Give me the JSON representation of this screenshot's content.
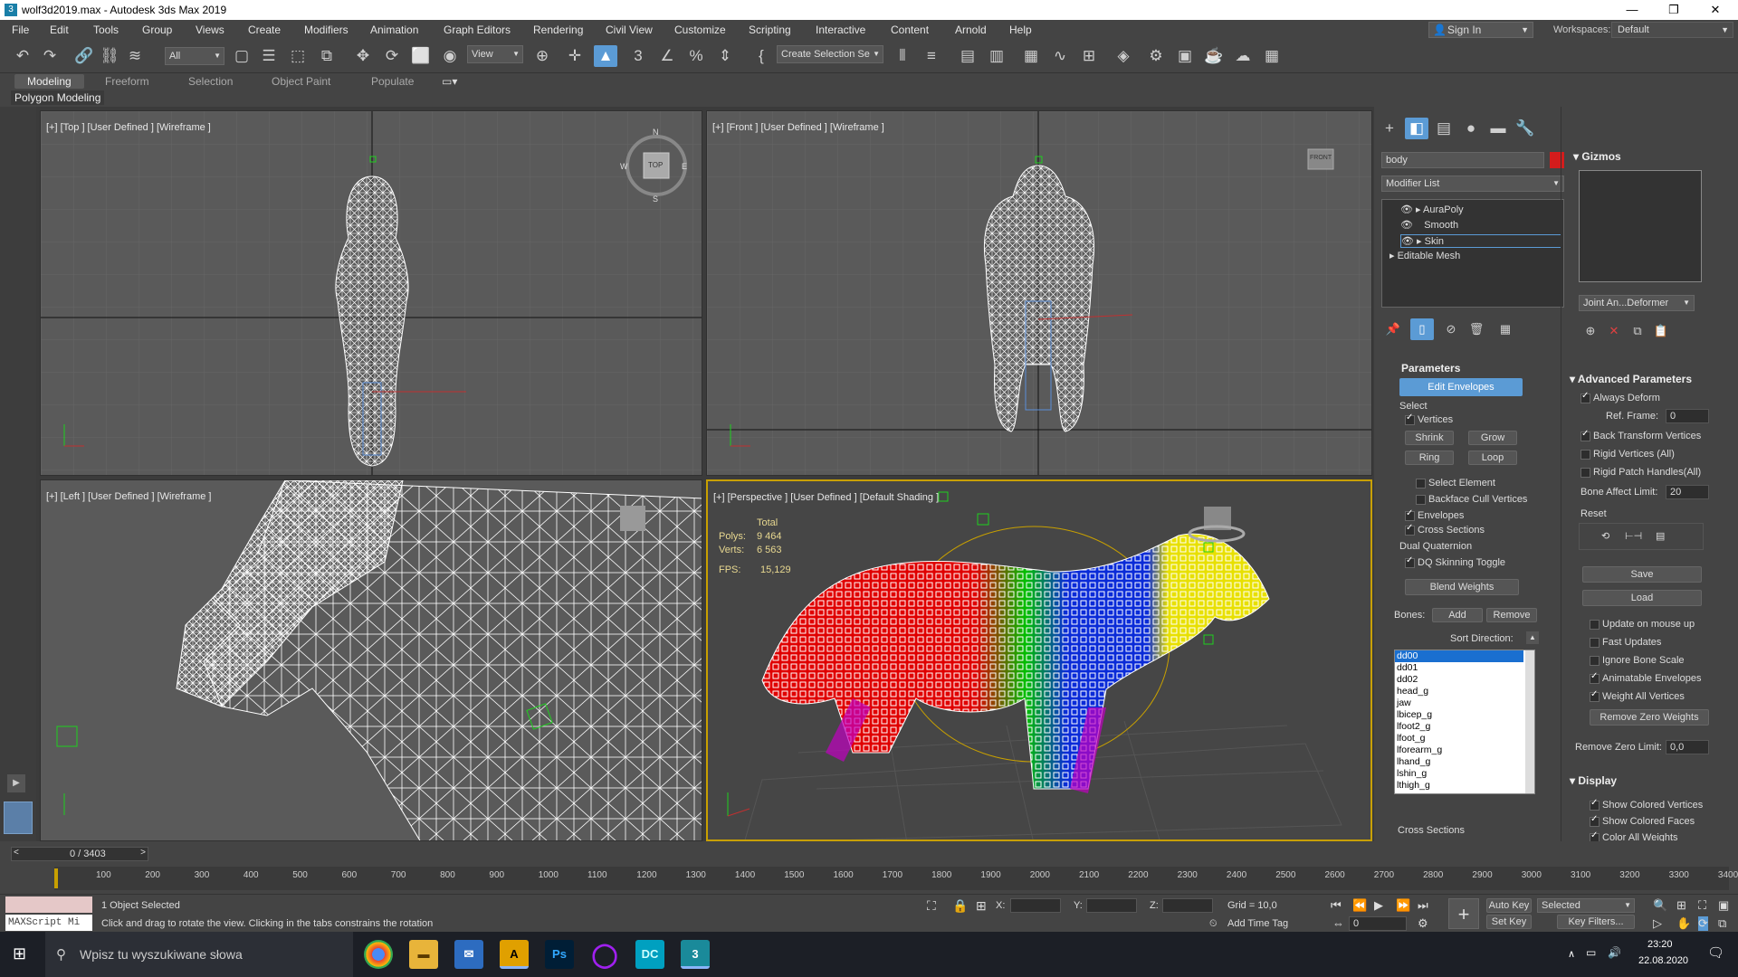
{
  "window": {
    "title": "wolf3d2019.max - Autodesk 3ds Max 2019",
    "minimize": "—",
    "maximize": "❐",
    "close": "✕"
  },
  "menu": {
    "items": [
      "File",
      "Edit",
      "Tools",
      "Group",
      "Views",
      "Create",
      "Modifiers",
      "Animation",
      "Graph Editors",
      "Rendering",
      "Civil View",
      "Customize",
      "Scripting",
      "Interactive",
      "Content",
      "Arnold",
      "Help"
    ],
    "sign_in": "Sign In",
    "workspaces_label": "Workspaces:",
    "workspace": "Default"
  },
  "toolbar": {
    "filter": "All",
    "ref_coord": "View",
    "selection_set": "Create Selection Se"
  },
  "ribbon": {
    "tabs": [
      "Modeling",
      "Freeform",
      "Selection",
      "Object Paint",
      "Populate"
    ],
    "active": "Modeling",
    "panel": "Polygon Modeling"
  },
  "viewports": {
    "top": {
      "label": "[+] [Top ] [User Defined ] [Wireframe ]"
    },
    "front": {
      "label": "[+] [Front ] [User Defined ] [Wireframe ]"
    },
    "left": {
      "label": "[+] [Left ] [User Defined ] [Wireframe ]"
    },
    "persp": {
      "label": "[+] [Perspective ] [User Defined ] [Default Shading ]",
      "stats": {
        "total": "Total",
        "polys_label": "Polys:",
        "polys": "9 464",
        "verts_label": "Verts:",
        "verts": "6 563",
        "fps_label": "FPS:",
        "fps": "15,129"
      }
    },
    "viewcube": {
      "top": "TOP",
      "front": "FRONT",
      "n": "N",
      "s": "S",
      "w": "W",
      "e": "E"
    }
  },
  "command_panel": {
    "object_name": "body",
    "object_color": "#d41c1c",
    "modifier_list": "Modifier List",
    "stack": [
      "AuraPoly",
      "Smooth",
      "Skin",
      "Editable Mesh"
    ],
    "parameters": {
      "title": "Parameters",
      "edit_envelopes": "Edit Envelopes",
      "select_label": "Select",
      "vertices": "Vertices",
      "shrink": "Shrink",
      "grow": "Grow",
      "ring": "Ring",
      "loop": "Loop",
      "select_element": "Select Element",
      "backface": "Backface Cull Vertices",
      "envelopes": "Envelopes",
      "cross_sections": "Cross Sections",
      "dual_quaternion": "Dual Quaternion",
      "dq_toggle": "DQ Skinning Toggle",
      "blend_weights": "Blend Weights",
      "bones_label": "Bones:",
      "add": "Add",
      "remove": "Remove",
      "sort_direction": "Sort Direction:",
      "bones": [
        "dd00",
        "dd01",
        "dd02",
        "head_g",
        "jaw",
        "lbicep_g",
        "lfoot2_g",
        "lfoot_g",
        "lforearm_g",
        "lhand_g",
        "lshin_g",
        "lthigh_g"
      ],
      "cross_sections_footer": "Cross Sections"
    },
    "gizmos": {
      "title": "Gizmos",
      "deformer": "Joint An...Deformer"
    },
    "advanced": {
      "title": "Advanced Parameters",
      "always_deform": "Always Deform",
      "ref_frame_label": "Ref. Frame:",
      "ref_frame": "0",
      "back_transform": "Back Transform Vertices",
      "rigid_vertices": "Rigid Vertices (All)",
      "rigid_patch": "Rigid Patch Handles(All)",
      "bone_affect_label": "Bone Affect Limit:",
      "bone_affect": "20",
      "reset_label": "Reset",
      "save": "Save",
      "load": "Load",
      "update_mouse": "Update on mouse up",
      "fast_updates": "Fast Updates",
      "ignore_bone_scale": "Ignore Bone Scale",
      "animatable_env": "Animatable Envelopes",
      "weight_all": "Weight All Vertices",
      "remove_zero": "Remove Zero Weights",
      "remove_zero_limit_label": "Remove Zero Limit:",
      "remove_zero_limit": "0,0"
    },
    "display": {
      "title": "Display",
      "show_colored_vertices": "Show Colored Vertices",
      "show_colored_faces": "Show Colored Faces",
      "color_all_weights": "Color All Weights"
    }
  },
  "timeline": {
    "frame": "0 / 3403",
    "ticks": [
      "100",
      "200",
      "300",
      "400",
      "500",
      "600",
      "700",
      "800",
      "900",
      "1000",
      "1100",
      "1200",
      "1300",
      "1400",
      "1500",
      "1600",
      "1700",
      "1800",
      "1900",
      "2000",
      "2100",
      "2200",
      "2300",
      "2400",
      "2500",
      "2600",
      "2700",
      "2800",
      "2900",
      "3000",
      "3100",
      "3200",
      "3300",
      "3400"
    ]
  },
  "status": {
    "maxscript": "MAXScript Mi",
    "selected": "1 Object Selected",
    "hint": "Click and drag to rotate the view.  Clicking in the tabs constrains the rotation",
    "x_label": "X:",
    "y_label": "Y:",
    "z_label": "Z:",
    "grid": "Grid = 10,0",
    "add_time_tag": "Add Time Tag",
    "auto_key": "Auto Key",
    "set_key": "Set Key",
    "key_mode": "Selected",
    "key_filters": "Key Filters...",
    "frame_input": "0"
  },
  "taskbar": {
    "search": "Wpisz tu wyszukiwane słowa",
    "time": "23:20",
    "date": "22.08.2020"
  }
}
